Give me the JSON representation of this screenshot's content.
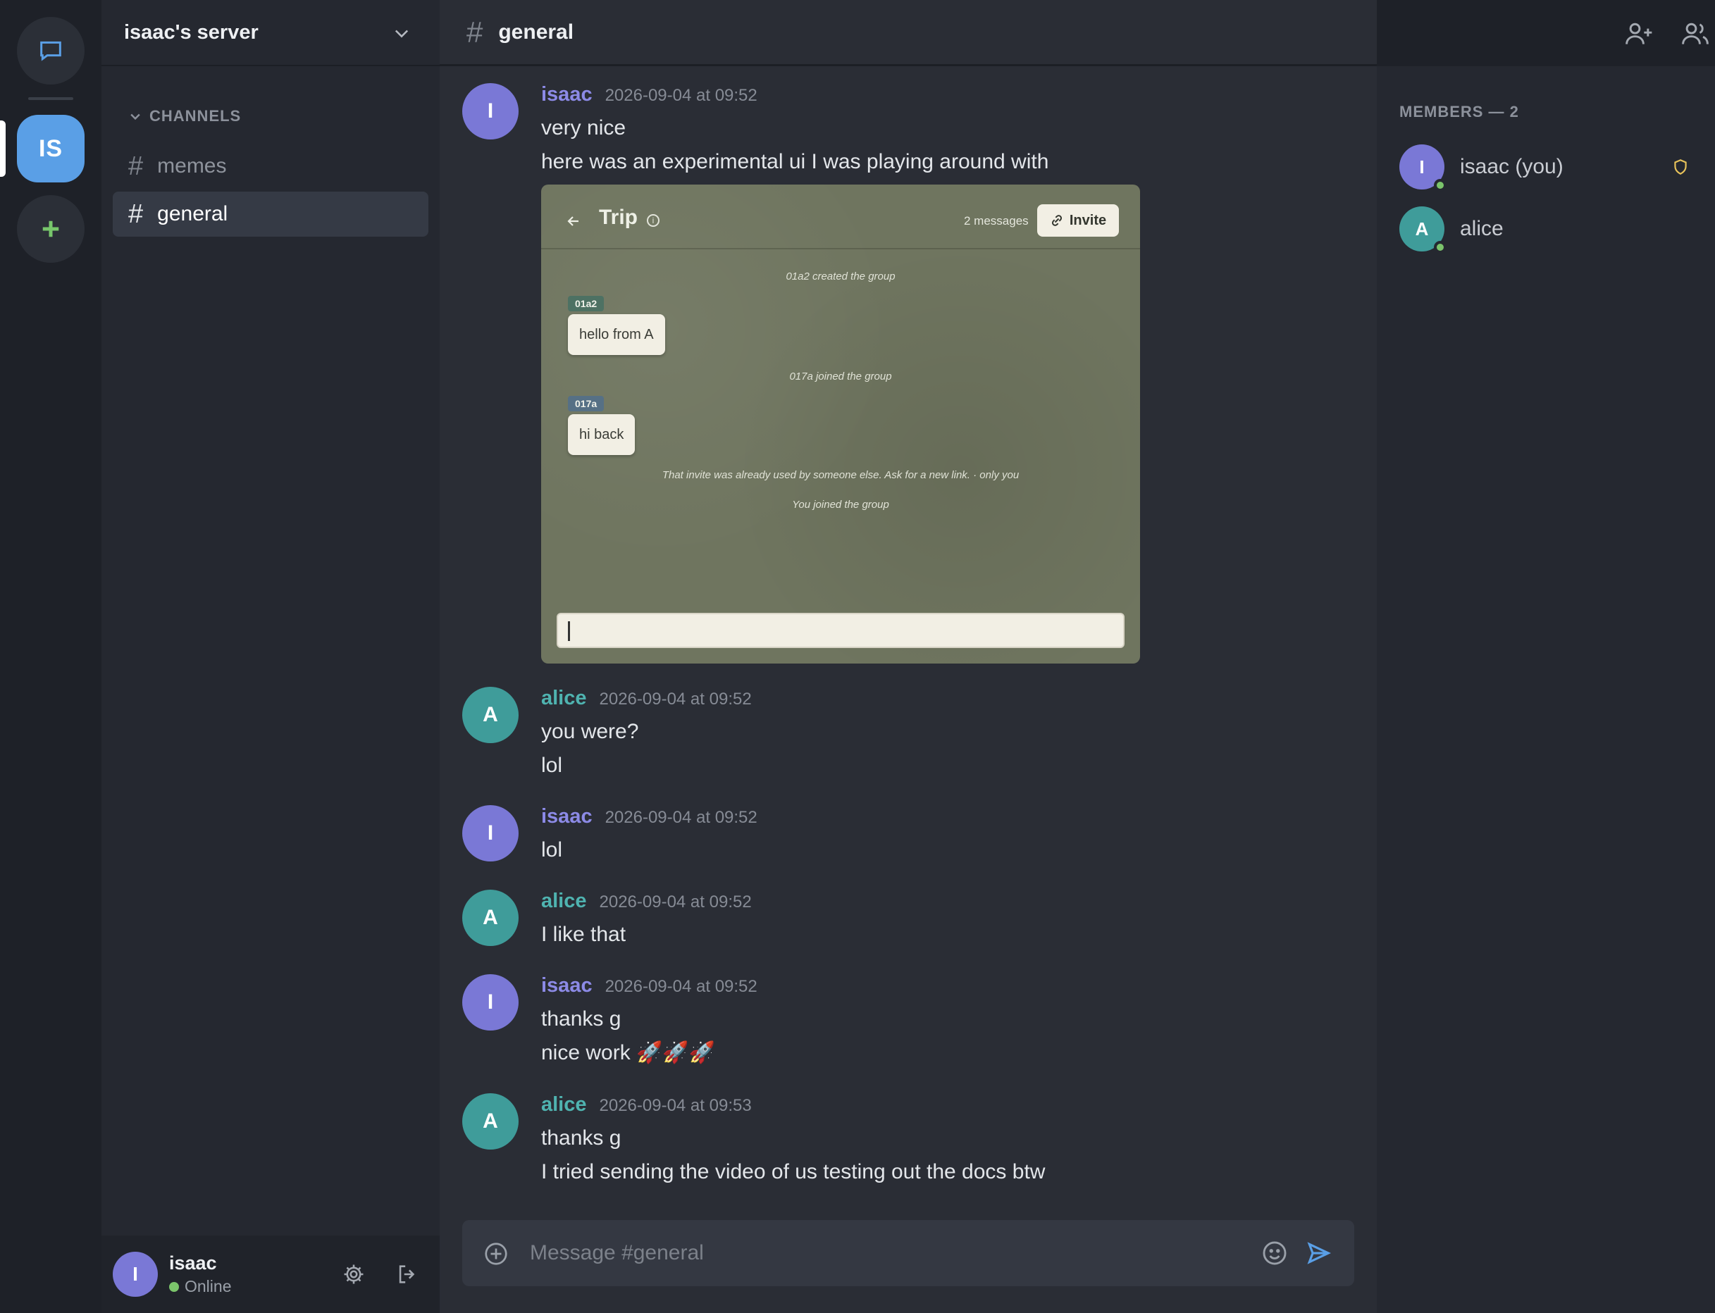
{
  "server": {
    "name": "isaac's server",
    "initials": "IS"
  },
  "sidebar": {
    "section_label": "CHANNELS",
    "channels": [
      {
        "name": "memes",
        "active": false
      },
      {
        "name": "general",
        "active": true
      }
    ]
  },
  "current_user": {
    "initial": "I",
    "name": "isaac",
    "status": "Online"
  },
  "chat": {
    "channel_hash": "#",
    "channel_name": "general",
    "messages": [
      {
        "initial": "I",
        "author": "isaac",
        "timestamp": "2026-09-04 at 09:52",
        "lines": [
          "very nice",
          "here was an experimental ui I was playing around with"
        ]
      },
      {
        "initial": "A",
        "author": "alice",
        "timestamp": "2026-09-04 at 09:52",
        "lines": [
          "you were?",
          "lol"
        ]
      },
      {
        "initial": "I",
        "author": "isaac",
        "timestamp": "2026-09-04 at 09:52",
        "lines": [
          "lol"
        ]
      },
      {
        "initial": "A",
        "author": "alice",
        "timestamp": "2026-09-04 at 09:52",
        "lines": [
          "I like that"
        ]
      },
      {
        "initial": "I",
        "author": "isaac",
        "timestamp": "2026-09-04 at 09:52",
        "lines": [
          "thanks g",
          "nice work 🚀🚀🚀"
        ]
      },
      {
        "initial": "A",
        "author": "alice",
        "timestamp": "2026-09-04 at 09:53",
        "lines": [
          "thanks g",
          "I tried sending the video of us testing out the docs btw"
        ]
      }
    ],
    "attachment": {
      "title": "Trip",
      "message_count": "2 messages",
      "invite_label": "Invite",
      "events": [
        "01a2 created the group",
        "017a joined the group",
        "That invite was already used by someone else. Ask for a new link. · only you",
        "You joined the group"
      ],
      "bubbles": [
        {
          "tag": "01a2",
          "text": "hello from A"
        },
        {
          "tag": "017a",
          "text": "hi back"
        }
      ]
    }
  },
  "composer": {
    "placeholder": "Message #general"
  },
  "members": {
    "header": "MEMBERS — 2",
    "list": [
      {
        "initial": "I",
        "name": "isaac (you)"
      },
      {
        "initial": "A",
        "name": "alice"
      }
    ]
  },
  "colors": {
    "accent": "#5a9fe6",
    "isaac": "#7a78d6",
    "alice": "#3f9c9a",
    "online": "#7bc46b"
  }
}
